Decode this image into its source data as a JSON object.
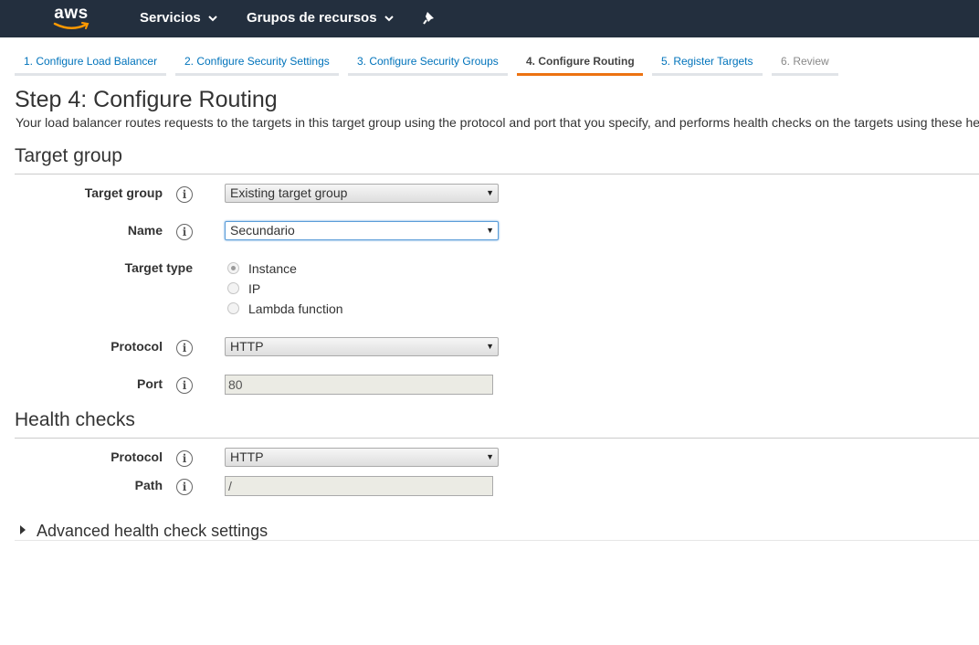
{
  "topnav": {
    "logo_text": "aws",
    "services_label": "Servicios",
    "resource_groups_label": "Grupos de recursos"
  },
  "tabs": [
    {
      "label": "1. Configure Load Balancer",
      "state": "link"
    },
    {
      "label": "2. Configure Security Settings",
      "state": "link"
    },
    {
      "label": "3. Configure Security Groups",
      "state": "link"
    },
    {
      "label": "4. Configure Routing",
      "state": "active"
    },
    {
      "label": "5. Register Targets",
      "state": "link"
    },
    {
      "label": "6. Review",
      "state": "disabled"
    }
  ],
  "page": {
    "title": "Step 4: Configure Routing",
    "description": "Your load balancer routes requests to the targets in this target group using the protocol and port that you specify, and performs health checks on the targets using these he"
  },
  "target_group": {
    "section_title": "Target group",
    "target_group_label": "Target group",
    "target_group_value": "Existing target group",
    "name_label": "Name",
    "name_value": "Secundario",
    "target_type_label": "Target type",
    "target_type_options": [
      {
        "label": "Instance",
        "checked": true
      },
      {
        "label": "IP",
        "checked": false
      },
      {
        "label": "Lambda function",
        "checked": false
      }
    ],
    "protocol_label": "Protocol",
    "protocol_value": "HTTP",
    "port_label": "Port",
    "port_value": "80"
  },
  "health_checks": {
    "section_title": "Health checks",
    "protocol_label": "Protocol",
    "protocol_value": "HTTP",
    "path_label": "Path",
    "path_value": "/"
  },
  "advanced": {
    "label": "Advanced health check settings"
  },
  "icons": {
    "info": "i",
    "dropdown_arrow": "▼"
  },
  "colors": {
    "nav_bg": "#232f3e",
    "link": "#0073bb",
    "active_tab_underline": "#ec7211",
    "focus_border": "#5b9dd9"
  }
}
